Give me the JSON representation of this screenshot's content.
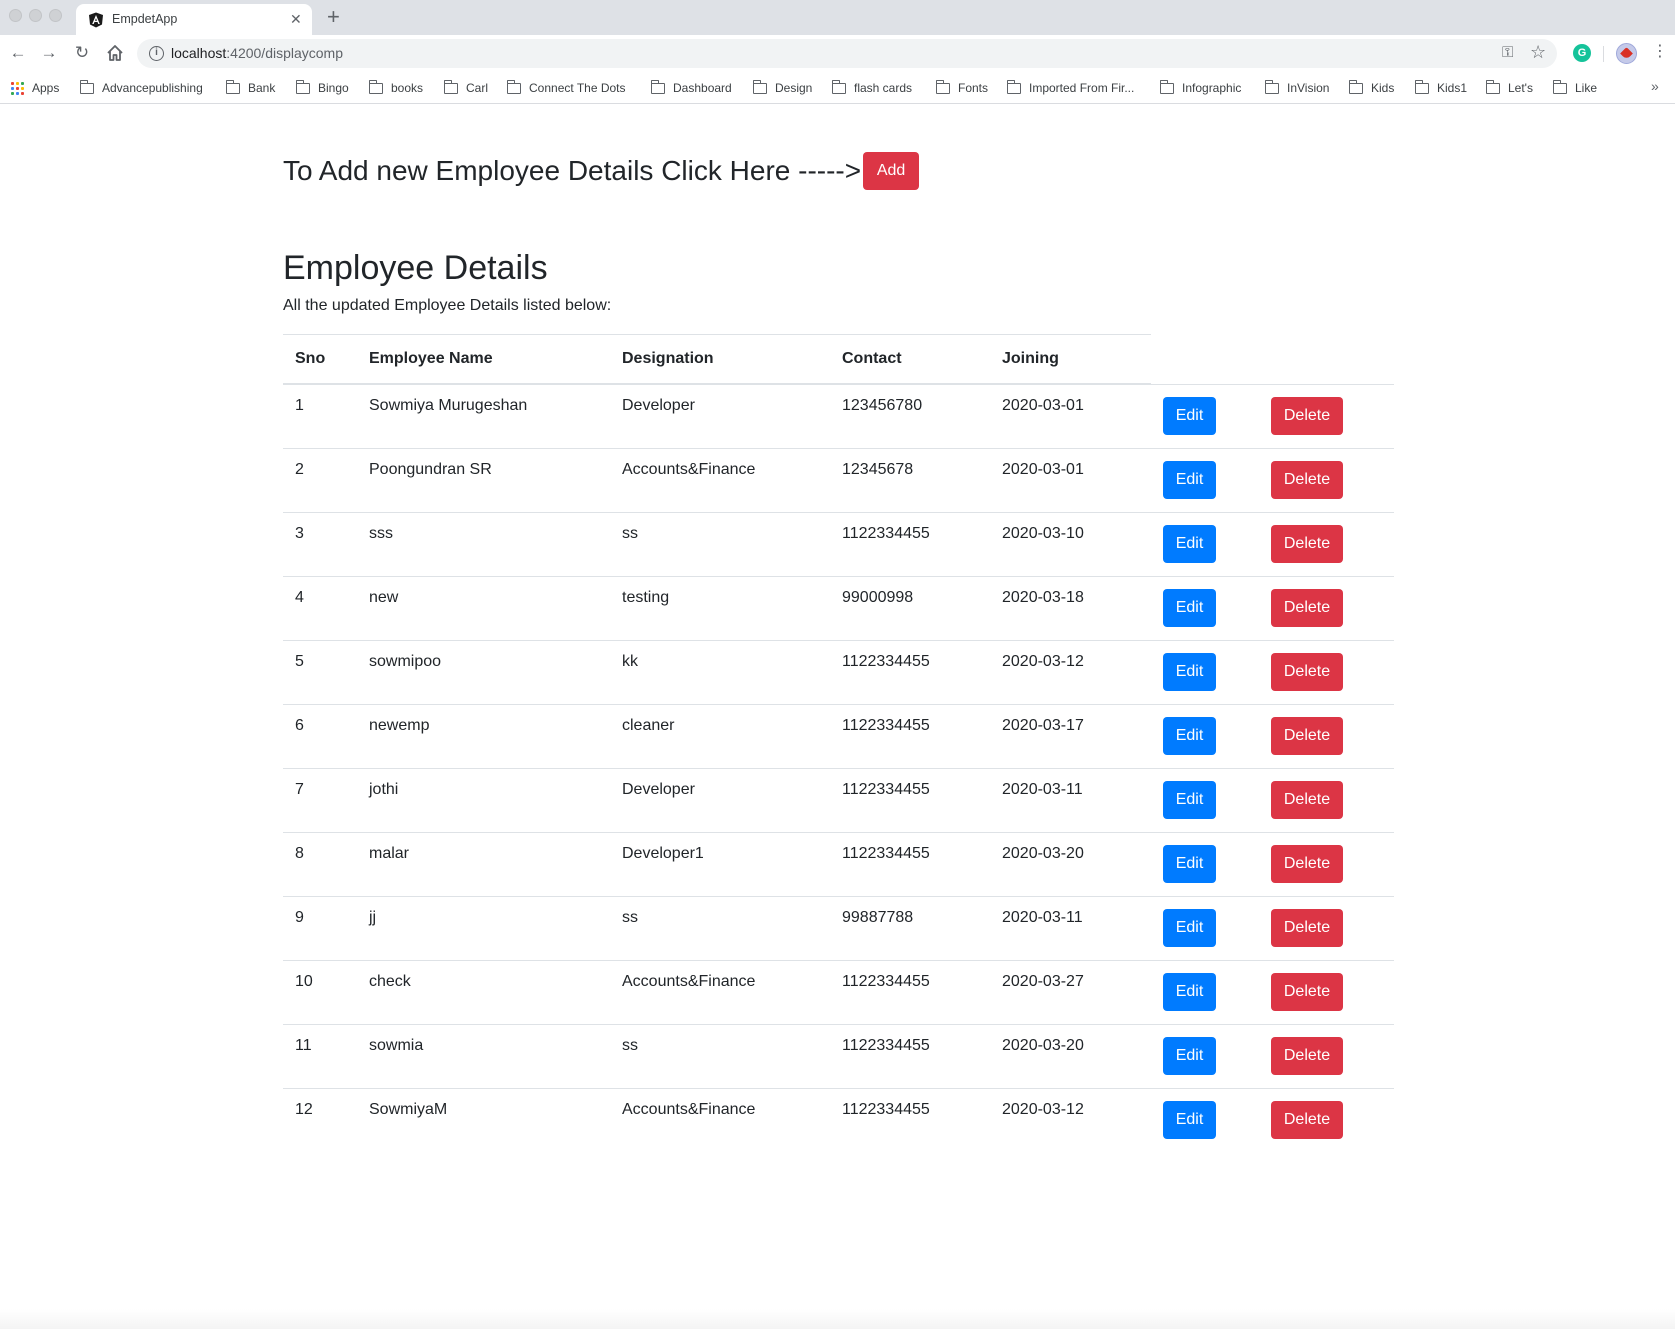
{
  "browser": {
    "tab_title": "EmpdetApp",
    "tab_close": "✕",
    "new_tab": "+",
    "url_host": "localhost",
    "url_path": ":4200/displaycomp",
    "bookmarks": [
      {
        "label": "Apps",
        "icon": "apps-grid-icon"
      },
      {
        "label": "Advancepublishing",
        "icon": "folder-icon"
      },
      {
        "label": "Bank",
        "icon": "folder-icon"
      },
      {
        "label": "Bingo",
        "icon": "folder-icon"
      },
      {
        "label": "books",
        "icon": "folder-icon"
      },
      {
        "label": "Carl",
        "icon": "folder-icon"
      },
      {
        "label": "Connect The Dots",
        "icon": "folder-icon"
      },
      {
        "label": "Dashboard",
        "icon": "folder-icon"
      },
      {
        "label": "Design",
        "icon": "folder-icon"
      },
      {
        "label": "flash cards",
        "icon": "folder-icon"
      },
      {
        "label": "Fonts",
        "icon": "folder-icon"
      },
      {
        "label": "Imported From Fir...",
        "icon": "folder-icon"
      },
      {
        "label": "Infographic",
        "icon": "folder-icon"
      },
      {
        "label": "InVision",
        "icon": "folder-icon"
      },
      {
        "label": "Kids",
        "icon": "folder-icon"
      },
      {
        "label": "Kids1",
        "icon": "folder-icon"
      },
      {
        "label": "Let's",
        "icon": "folder-icon"
      },
      {
        "label": "Like",
        "icon": "folder-icon"
      }
    ],
    "bookmarks_more": "»"
  },
  "page": {
    "add_prompt": "To Add new Employee Details Click Here ----->",
    "add_button": "Add",
    "title": "Employee Details",
    "subtitle": "All the updated Employee Details listed below:"
  },
  "table": {
    "headers": [
      "Sno",
      "Employee Name",
      "Designation",
      "Contact",
      "Joining"
    ],
    "edit_label": "Edit",
    "delete_label": "Delete",
    "rows": [
      [
        "1",
        "Sowmiya Murugeshan",
        "Developer",
        "123456780",
        "2020-03-01"
      ],
      [
        "2",
        "Poongundran SR",
        "Accounts&Finance",
        "12345678",
        "2020-03-01"
      ],
      [
        "3",
        "sss",
        "ss",
        "1122334455",
        "2020-03-10"
      ],
      [
        "4",
        "new",
        "testing",
        "99000998",
        "2020-03-18"
      ],
      [
        "5",
        "sowmipoo",
        "kk",
        "1122334455",
        "2020-03-12"
      ],
      [
        "6",
        "newemp",
        "cleaner",
        "1122334455",
        "2020-03-17"
      ],
      [
        "7",
        "jothi",
        "Developer",
        "1122334455",
        "2020-03-11"
      ],
      [
        "8",
        "malar",
        "Developer1",
        "1122334455",
        "2020-03-20"
      ],
      [
        "9",
        "jj",
        "ss",
        "99887788",
        "2020-03-11"
      ],
      [
        "10",
        "check",
        "Accounts&Finance",
        "1122334455",
        "2020-03-27"
      ],
      [
        "11",
        "sowmia",
        "ss",
        "1122334455",
        "2020-03-20"
      ],
      [
        "12",
        "SowmiyaM",
        "Accounts&Finance",
        "1122334455",
        "2020-03-12"
      ]
    ]
  },
  "colors": {
    "danger": "#dc3545",
    "primary": "#007bff",
    "text": "#212529",
    "border": "#dee2e6"
  }
}
